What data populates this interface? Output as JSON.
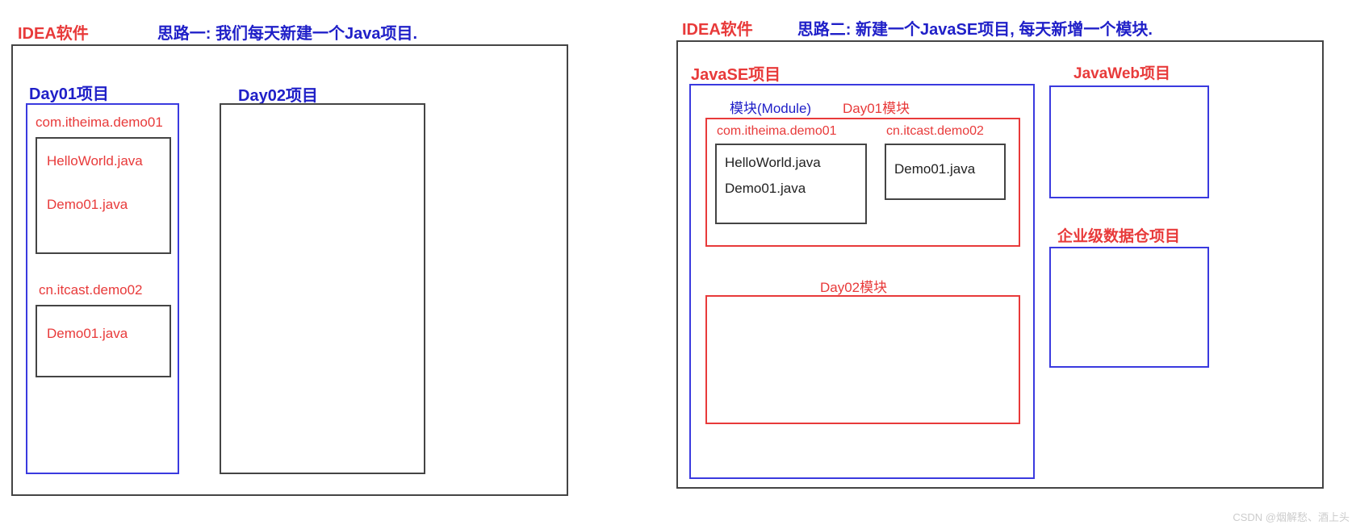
{
  "left": {
    "idea_label": "IDEA软件",
    "approach": "思路一: 我们每天新建一个Java项目.",
    "day01_title": "Day01项目",
    "pkg1_label": "com.itheima.demo01",
    "pkg1_file1": "HelloWorld.java",
    "pkg1_file2": "Demo01.java",
    "pkg2_label": "cn.itcast.demo02",
    "pkg2_file1": "Demo01.java",
    "day02_title": "Day02项目"
  },
  "right": {
    "idea_label": "IDEA软件",
    "approach": "思路二: 新建一个JavaSE项目, 每天新增一个模块.",
    "javase_title": "JavaSE项目",
    "module_label": "模块(Module)",
    "module_day01_label": "Day01模块",
    "pkg_r1_label": "com.itheima.demo01",
    "pkg_r1_file1": "HelloWorld.java",
    "pkg_r1_file2": "Demo01.java",
    "pkg_r2_label": "cn.itcast.demo02",
    "pkg_r2_file1": "Demo01.java",
    "module_day02_label": "Day02模块",
    "javaweb_title": "JavaWeb项目",
    "entwh_title": "企业级数据仓项目"
  },
  "watermark": "CSDN @烟解愁、酒上头"
}
